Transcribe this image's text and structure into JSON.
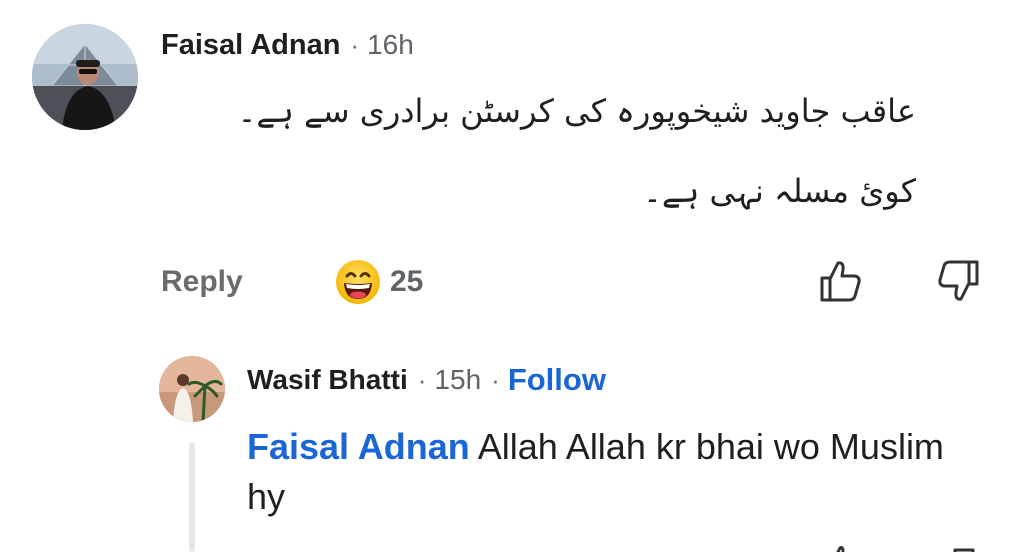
{
  "comment": {
    "author": "Faisal Adnan",
    "separator": "·",
    "time": "16h",
    "text_line_1": "عاقب جاوید شیخوپورہ کی کرسٹن برادری سے ہے۔",
    "text_line_2": "کوئ مسلہ نہی ہے۔",
    "reply_label": "Reply",
    "reaction_count": "25",
    "reaction_icon": "grinning-face-emoji",
    "like_icon": "thumbs-up-icon",
    "dislike_icon": "thumbs-down-icon"
  },
  "reply": {
    "author": "Wasif Bhatti",
    "separator": "·",
    "time": "15h",
    "separator_2": "·",
    "follow_label": "Follow",
    "mention": "Faisal Adnan",
    "text": " Allah Allah kr bhai wo Muslim hy"
  },
  "colors": {
    "link_blue": "#1a66d6",
    "text_primary": "#1f1f1f",
    "text_secondary": "#5f6368",
    "thread_line": "#e6e6e6"
  }
}
